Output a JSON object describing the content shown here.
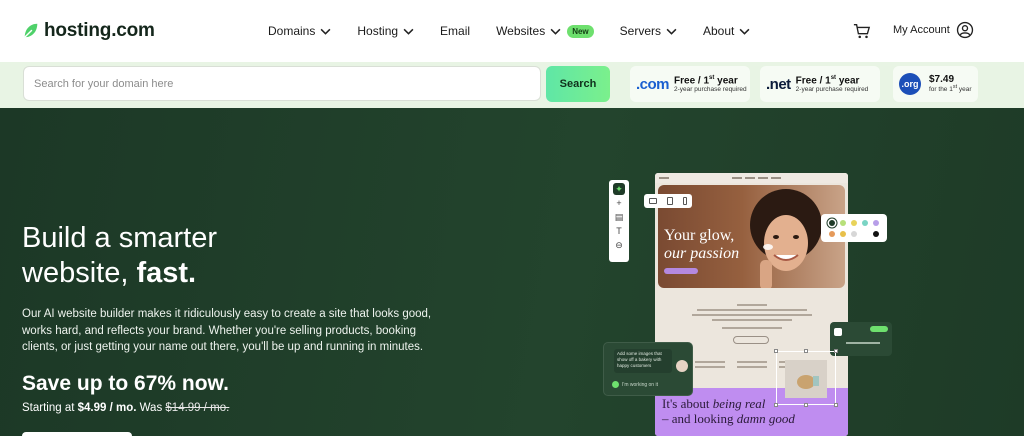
{
  "nav": {
    "logo_text": "hosting.com",
    "menu": [
      {
        "label": "Domains",
        "chevron": true
      },
      {
        "label": "Hosting",
        "chevron": true
      },
      {
        "label": "Email",
        "chevron": false
      },
      {
        "label": "Websites",
        "chevron": true,
        "badge": "New"
      },
      {
        "label": "Servers",
        "chevron": true
      },
      {
        "label": "About",
        "chevron": true
      }
    ],
    "account_label": "My Account"
  },
  "search": {
    "placeholder": "Search for your domain here",
    "button_label": "Search"
  },
  "tlds": [
    {
      "name": ".com",
      "main": "Free / 1",
      "sup": "st",
      "main_suffix": " year",
      "sub": "2-year purchase required"
    },
    {
      "name": ".net",
      "main": "Free / 1",
      "sup": "st",
      "main_suffix": " year",
      "sub": "2-year purchase required"
    },
    {
      "name": ".org",
      "main": "$7.49",
      "sub_prefix": "for the 1",
      "sub_sup": "st",
      "sub_suffix": " year"
    }
  ],
  "hero": {
    "title_line1": "Build a smarter",
    "title_line2": "website, ",
    "title_bold": "fast.",
    "description": "Our AI website builder makes it ridiculously easy to create a site that looks good, works hard, and reflects your brand. Whether you're selling products, booking clients, or just getting your name out there, you'll be up and running in minutes.",
    "save_prefix": "Save up to ",
    "save_bold": "67%",
    "save_suffix": " now.",
    "price_prefix": "Starting at ",
    "price_bold": "$4.99 / mo.",
    "price_was": " Was ",
    "price_old": "$14.99 / mo."
  },
  "mockup": {
    "glow_line1": "Your glow,",
    "glow_line2": "our passion",
    "purple_line1_a": "It's about ",
    "purple_line1_b": "being real",
    "purple_line2_a": "– and looking ",
    "purple_line2_b": "damn good",
    "ai_prompt": "Add some images that show off a bakery with happy customers",
    "ai_status": "I'm working on it",
    "palette_colors": [
      "#1f3b28",
      "#b7e07a",
      "#e8d35a",
      "#7ad4c4",
      "#b79ee8",
      "#e59a5a",
      "#e8c04a",
      "#d7d7d7",
      "#111111"
    ]
  }
}
